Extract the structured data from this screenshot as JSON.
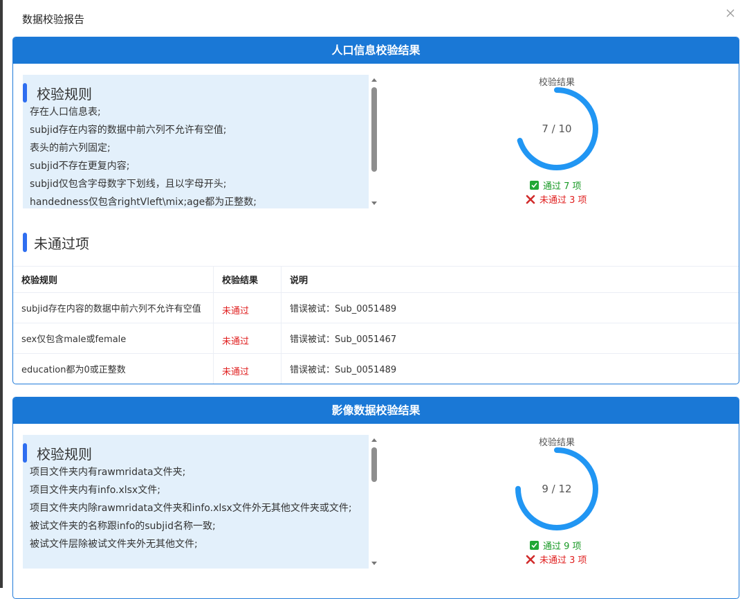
{
  "dialog": {
    "title": "数据校验报告"
  },
  "sections": [
    {
      "header": "人口信息校验结果",
      "rules_heading": "校验规则",
      "rules": [
        "存在人口信息表;",
        "subjid存在内容的数据中前六列不允许有空值;",
        "表头的前六列固定;",
        "subjid不存在更复内容;",
        "subjid仅包含字母数字下划线，且以字母开头;",
        "handedness仅包含rightVleft\\mix;age都为正整数;"
      ],
      "result_title": "校验结果",
      "progress": {
        "passed": 7,
        "total": 10,
        "text": "7 / 10",
        "color": "#2196f3"
      },
      "pass_text": "通过 7 项",
      "fail_text": "未通过 3 项",
      "failed_heading": "未通过项",
      "table": {
        "headers": [
          "校验规则",
          "校验结果",
          "说明"
        ],
        "rows": [
          [
            "subjid存在内容的数据中前六列不允许有空值",
            "未通过",
            "错误被试：Sub_0051489"
          ],
          [
            "sex仅包含male或female",
            "未通过",
            "错误被试：Sub_0051467"
          ],
          [
            "education都为0或正整数",
            "未通过",
            "错误被试：Sub_0051489"
          ]
        ]
      }
    },
    {
      "header": "影像数据校验结果",
      "rules_heading": "校验规则",
      "rules": [
        "项目文件夹内有rawmridata文件夹;",
        "项目文件夹内有info.xlsx文件;",
        "项目文件夹内除rawmridata文件夹和info.xlsx文件外无其他文件夹或文件;",
        "被试文件夹的名称跟info的subjid名称一致;",
        "被试文件层除被试文件夹外无其他文件;"
      ],
      "result_title": "校验结果",
      "progress": {
        "passed": 9,
        "total": 12,
        "text": "9 / 12",
        "color": "#2196f3"
      },
      "pass_text": "通过 9 项",
      "fail_text": "未通过 3 项"
    }
  ],
  "icons": {
    "close": "close-icon",
    "check": "check-icon",
    "cross": "cross-icon"
  },
  "colors": {
    "header_blue": "#1a78d6",
    "rules_bg": "#e3f0fb",
    "accent": "#2f6ef0",
    "pass": "#1a9a27",
    "fail": "#e02020"
  }
}
